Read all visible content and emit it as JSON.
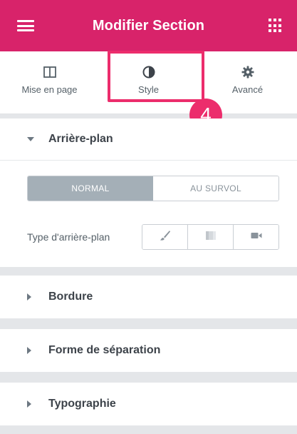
{
  "header": {
    "title": "Modifier Section",
    "bg_color": "#d8236a",
    "menu_icon": "hamburger-icon",
    "grid_icon": "grid-icon"
  },
  "tabs": [
    {
      "label": "Mise en page",
      "icon": "layout-columns-icon"
    },
    {
      "label": "Style",
      "icon": "half-circle-contrast-icon",
      "active": true
    },
    {
      "label": "Avancé",
      "icon": "gear-icon"
    }
  ],
  "callout": {
    "number": "4",
    "color": "#ec2d6c"
  },
  "background_section": {
    "title": "Arrière-plan",
    "state_tabs": [
      "NORMAL",
      "AU SURVOL"
    ],
    "active_state": "NORMAL",
    "type_label": "Type d'arrière-plan",
    "type_choices": [
      "brush-icon",
      "gradient-icon",
      "video-icon"
    ]
  },
  "collapsed_sections": [
    {
      "title": "Bordure"
    },
    {
      "title": "Forme de séparation"
    },
    {
      "title": "Typographie"
    }
  ]
}
